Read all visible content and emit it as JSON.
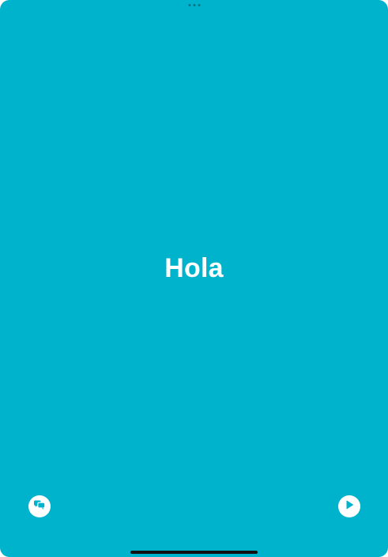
{
  "flashcard": {
    "text": "Hola"
  },
  "controls": {
    "left_button_icon": "speech-bubbles-icon",
    "right_button_icon": "play-icon"
  },
  "colors": {
    "background": "#00b3cc",
    "text": "#ffffff",
    "button": "#ffffff",
    "icon": "#00b3cc"
  }
}
